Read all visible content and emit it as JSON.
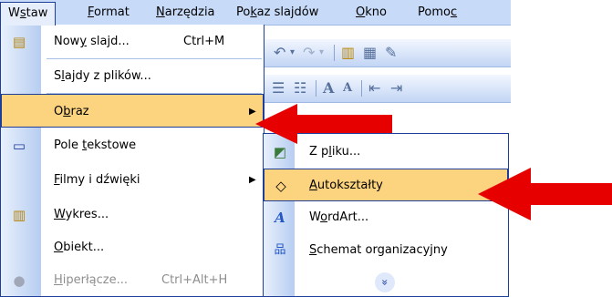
{
  "menubar": {
    "items": [
      {
        "pre": "W",
        "ul": "s",
        "post": "taw",
        "state": "active"
      },
      {
        "pre": "",
        "ul": "F",
        "post": "ormat",
        "state": ""
      },
      {
        "pre": "",
        "ul": "N",
        "post": "arzędzia",
        "state": ""
      },
      {
        "pre": "Po",
        "ul": "k",
        "post": "az slajdów",
        "state": ""
      },
      {
        "pre": "",
        "ul": "O",
        "post": "kno",
        "state": ""
      },
      {
        "pre": "Pomo",
        "ul": "c",
        "post": "",
        "state": ""
      }
    ]
  },
  "main_menu": {
    "items": [
      {
        "pre": "Now",
        "ul": "y",
        "post": " slajd...",
        "shortcut": "Ctrl+M",
        "icon": "new-slide-icon",
        "glyph": "▤"
      },
      {
        "pre": "S",
        "ul": "l",
        "post": "ajdy z plików...",
        "shortcut": "",
        "icon": "",
        "glyph": ""
      },
      {
        "pre": "O",
        "ul": "b",
        "post": "raz",
        "shortcut": "",
        "icon": "",
        "glyph": "",
        "submenu": true
      },
      {
        "pre": "Pole ",
        "ul": "t",
        "post": "ekstowe",
        "shortcut": "",
        "icon": "text-box-icon",
        "glyph": "▭"
      },
      {
        "pre": "",
        "ul": "F",
        "post": "ilmy i dźwięki",
        "shortcut": "",
        "icon": "",
        "glyph": "",
        "submenu": true
      },
      {
        "pre": "",
        "ul": "W",
        "post": "ykres...",
        "shortcut": "",
        "icon": "chart-icon",
        "glyph": "▥"
      },
      {
        "pre": "",
        "ul": "O",
        "post": "biekt...",
        "shortcut": "",
        "icon": "",
        "glyph": ""
      },
      {
        "pre": "",
        "ul": "H",
        "post": "iperłącze...",
        "shortcut": "Ctrl+Alt+H",
        "icon": "hyperlink-icon",
        "glyph": "●",
        "disabled": true
      }
    ]
  },
  "sub_menu": {
    "items": [
      {
        "pre": "Z p",
        "ul": "l",
        "post": "iku...",
        "icon": "picture-from-file-icon",
        "glyph": "◩"
      },
      {
        "pre": "",
        "ul": "A",
        "post": "utokształty",
        "icon": "autoshapes-icon",
        "glyph": "◇"
      },
      {
        "pre": "W",
        "ul": "o",
        "post": "rdArt...",
        "icon": "wordart-icon",
        "glyph": "A"
      },
      {
        "pre": "",
        "ul": "S",
        "post": "chemat organizacyjny",
        "icon": "org-chart-icon",
        "glyph": "品"
      }
    ],
    "expand_glyph": "»"
  },
  "toolbar": {
    "row1_glyphs": [
      "↶",
      "▾",
      "↷",
      "▾",
      "▥",
      "▦",
      "✎"
    ],
    "row2_glyphs": [
      "☰",
      "☷",
      "A",
      "A",
      "⇤",
      "⇥"
    ]
  },
  "colors": {
    "highlight": "#fcd47f",
    "menu_border": "#1e3e9a",
    "arrow": "#e60000"
  }
}
